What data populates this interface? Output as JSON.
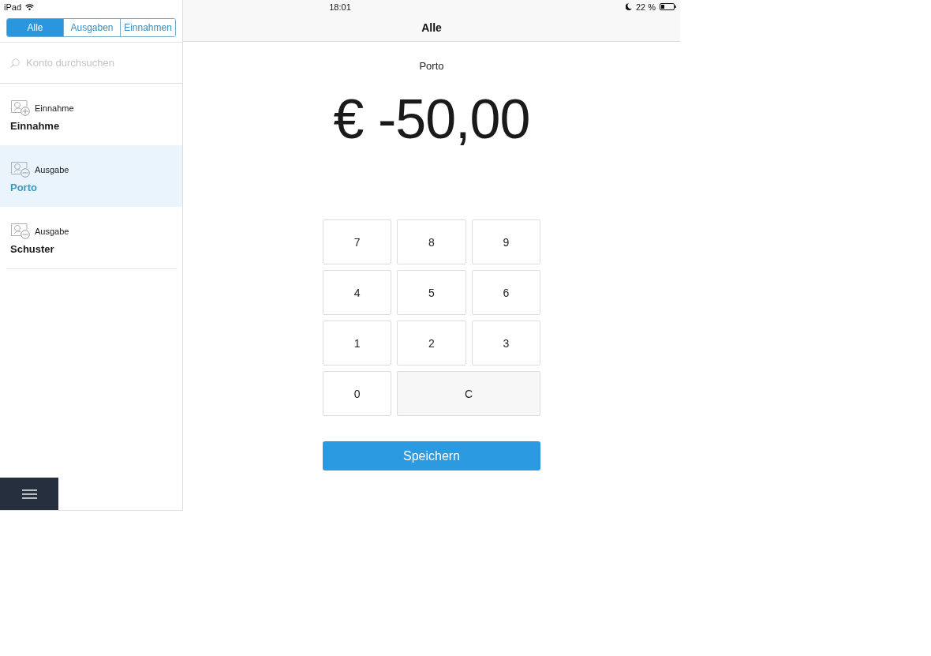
{
  "status_bar": {
    "device": "iPad",
    "time": "18:01",
    "battery": "22 %"
  },
  "filter_tabs": [
    {
      "label": "Alle",
      "selected": true
    },
    {
      "label": "Ausgaben",
      "selected": false
    },
    {
      "label": "Einnahmen",
      "selected": false
    }
  ],
  "search": {
    "placeholder": "Konto durchsuchen"
  },
  "accounts": [
    {
      "kind": "income",
      "type_label": "Einnahme",
      "name": "Einnahme",
      "selected": false
    },
    {
      "kind": "expense",
      "type_label": "Ausgabe",
      "name": "Porto",
      "selected": true
    },
    {
      "kind": "expense",
      "type_label": "Ausgabe",
      "name": "Schuster",
      "selected": false
    }
  ],
  "header": {
    "title": "Alle"
  },
  "detail": {
    "name": "Porto",
    "amount": "€ -50,00"
  },
  "keypad": [
    {
      "kind": "digit",
      "label": "7"
    },
    {
      "kind": "digit",
      "label": "8"
    },
    {
      "kind": "digit",
      "label": "9"
    },
    {
      "kind": "digit",
      "label": "4"
    },
    {
      "kind": "digit",
      "label": "5"
    },
    {
      "kind": "digit",
      "label": "6"
    },
    {
      "kind": "digit",
      "label": "1"
    },
    {
      "kind": "digit",
      "label": "2"
    },
    {
      "kind": "digit",
      "label": "3"
    },
    {
      "kind": "digit",
      "label": "0"
    },
    {
      "kind": "clear",
      "label": "C"
    }
  ],
  "save_button": {
    "label": "Speichern"
  }
}
